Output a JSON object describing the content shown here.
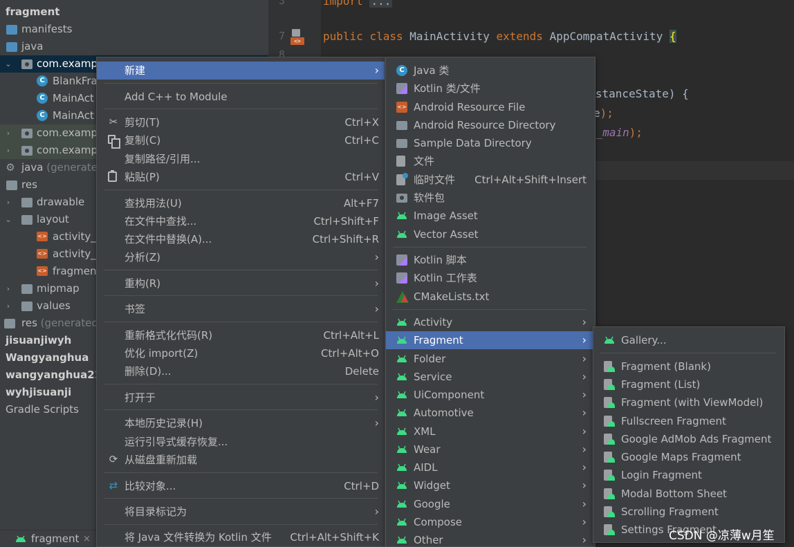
{
  "project_tree": {
    "items": [
      {
        "label": "fragment",
        "bold": true
      },
      {
        "label": "manifests"
      },
      {
        "label": "java"
      },
      {
        "label": "com.examp",
        "expanded": true
      },
      {
        "label": "BlankFrag"
      },
      {
        "label": "MainAct"
      },
      {
        "label": "MainAct"
      },
      {
        "label": "com.examp"
      },
      {
        "label": "com.examp"
      },
      {
        "label": "java",
        "suffix": "(generated"
      },
      {
        "label": "res"
      },
      {
        "label": "drawable"
      },
      {
        "label": "layout"
      },
      {
        "label": "activity_r"
      },
      {
        "label": "activity_r"
      },
      {
        "label": "fragmen"
      },
      {
        "label": "mipmap"
      },
      {
        "label": "values"
      },
      {
        "label": "res",
        "suffix": "(generated"
      },
      {
        "label": "jisuanjiwyh",
        "bold": true
      },
      {
        "label": "Wangyanghua",
        "bold": true
      },
      {
        "label": "wangyanghua21",
        "bold": true
      },
      {
        "label": "wyhjisuanji",
        "bold": true
      },
      {
        "label": "Gradle Scripts"
      }
    ],
    "bottom_tab": {
      "label": "fragment",
      "close": "×"
    }
  },
  "editor": {
    "line_numbers": [
      "3",
      "7",
      "8"
    ],
    "lines": {
      "import_kw": "import",
      "import_fold": "...",
      "public_kw": "public",
      "class_kw": "class",
      "class_name": "MainActivity",
      "extends_kw": "extends",
      "base_class": "AppCompatActivity",
      "open_brace": "{",
      "on_create_tail": "dInstanceState) {",
      "super_tail_a": "e",
      "super_tail_b": ");",
      "layout_tail_a": "y_main",
      "layout_tail_b": ");"
    }
  },
  "context_menu": {
    "items": [
      {
        "label": "新建",
        "submenu": true,
        "selected": true
      },
      {
        "label": "Add C++ to Module"
      },
      {
        "label": "剪切(T)",
        "shortcut": "Ctrl+X",
        "icon": "scissors-icon"
      },
      {
        "label": "复制(C)",
        "shortcut": "Ctrl+C",
        "icon": "copy-icon"
      },
      {
        "label": "复制路径/引用..."
      },
      {
        "label": "粘贴(P)",
        "shortcut": "Ctrl+V",
        "icon": "paste-icon"
      },
      {
        "label": "查找用法(U)",
        "shortcut": "Alt+F7"
      },
      {
        "label": "在文件中查找...",
        "shortcut": "Ctrl+Shift+F"
      },
      {
        "label": "在文件中替换(A)...",
        "shortcut": "Ctrl+Shift+R"
      },
      {
        "label": "分析(Z)",
        "submenu": true
      },
      {
        "label": "重构(R)",
        "submenu": true
      },
      {
        "label": "书签",
        "submenu": true
      },
      {
        "label": "重新格式化代码(R)",
        "shortcut": "Ctrl+Alt+L"
      },
      {
        "label": "优化 import(Z)",
        "shortcut": "Ctrl+Alt+O"
      },
      {
        "label": "删除(D)...",
        "shortcut": "Delete"
      },
      {
        "label": "打开于",
        "submenu": true
      },
      {
        "label": "本地历史记录(H)",
        "submenu": true
      },
      {
        "label": "运行引导式缓存恢复..."
      },
      {
        "label": "从磁盘重新加载",
        "icon": "reload-icon"
      },
      {
        "label": "比较对象...",
        "shortcut": "Ctrl+D",
        "icon": "compare-icon"
      },
      {
        "label": "将目录标记为",
        "submenu": true
      },
      {
        "label": "将 Java 文件转换为 Kotlin 文件",
        "shortcut": "Ctrl+Alt+Shift+K"
      }
    ]
  },
  "new_submenu": {
    "items": [
      {
        "label": "Java 类",
        "icon": "java-class-icon"
      },
      {
        "label": "Kotlin 类/文件",
        "icon": "kotlin-file-icon"
      },
      {
        "label": "Android Resource File",
        "icon": "resource-file-icon"
      },
      {
        "label": "Android Resource Directory",
        "icon": "folder-icon"
      },
      {
        "label": "Sample Data Directory",
        "icon": "folder-icon"
      },
      {
        "label": "文件",
        "icon": "file-icon"
      },
      {
        "label": "临时文件",
        "shortcut": "Ctrl+Alt+Shift+Insert",
        "icon": "scratch-file-icon"
      },
      {
        "label": "软件包",
        "icon": "package-icon"
      },
      {
        "label": "Image Asset",
        "icon": "android-icon"
      },
      {
        "label": "Vector Asset",
        "icon": "android-icon"
      },
      {
        "label": "Kotlin 脚本",
        "icon": "kotlin-script-icon"
      },
      {
        "label": "Kotlin 工作表",
        "icon": "kotlin-worksheet-icon"
      },
      {
        "label": "CMakeLists.txt",
        "icon": "cmake-icon"
      },
      {
        "label": "Activity",
        "submenu": true,
        "icon": "android-icon"
      },
      {
        "label": "Fragment",
        "submenu": true,
        "selected": true,
        "icon": "android-icon"
      },
      {
        "label": "Folder",
        "submenu": true,
        "icon": "android-icon"
      },
      {
        "label": "Service",
        "submenu": true,
        "icon": "android-icon"
      },
      {
        "label": "UiComponent",
        "submenu": true,
        "icon": "android-icon"
      },
      {
        "label": "Automotive",
        "submenu": true,
        "icon": "android-icon"
      },
      {
        "label": "XML",
        "submenu": true,
        "icon": "android-icon"
      },
      {
        "label": "Wear",
        "submenu": true,
        "icon": "android-icon"
      },
      {
        "label": "AIDL",
        "submenu": true,
        "icon": "android-icon"
      },
      {
        "label": "Widget",
        "submenu": true,
        "icon": "android-icon"
      },
      {
        "label": "Google",
        "submenu": true,
        "icon": "android-icon"
      },
      {
        "label": "Compose",
        "submenu": true,
        "icon": "android-icon"
      },
      {
        "label": "Other",
        "submenu": true,
        "icon": "android-icon"
      }
    ]
  },
  "fragment_submenu": {
    "items": [
      {
        "label": "Gallery...",
        "icon": "android-icon"
      },
      {
        "label": "Fragment (Blank)"
      },
      {
        "label": "Fragment (List)"
      },
      {
        "label": "Fragment (with ViewModel)"
      },
      {
        "label": "Fullscreen Fragment"
      },
      {
        "label": "Google AdMob Ads Fragment"
      },
      {
        "label": "Google Maps Fragment"
      },
      {
        "label": "Login Fragment"
      },
      {
        "label": "Modal Bottom Sheet"
      },
      {
        "label": "Scrolling Fragment"
      },
      {
        "label": "Settings Fragment"
      }
    ]
  },
  "submenu_arrow": "›",
  "watermark": "CSDN @凉薄w月笙",
  "colors": {
    "menu_bg": "#3c3f41",
    "selection": "#4b6eaf",
    "android_green": "#3ddc84",
    "editor_bg": "#2b2b2b",
    "keyword": "#cc7832"
  }
}
